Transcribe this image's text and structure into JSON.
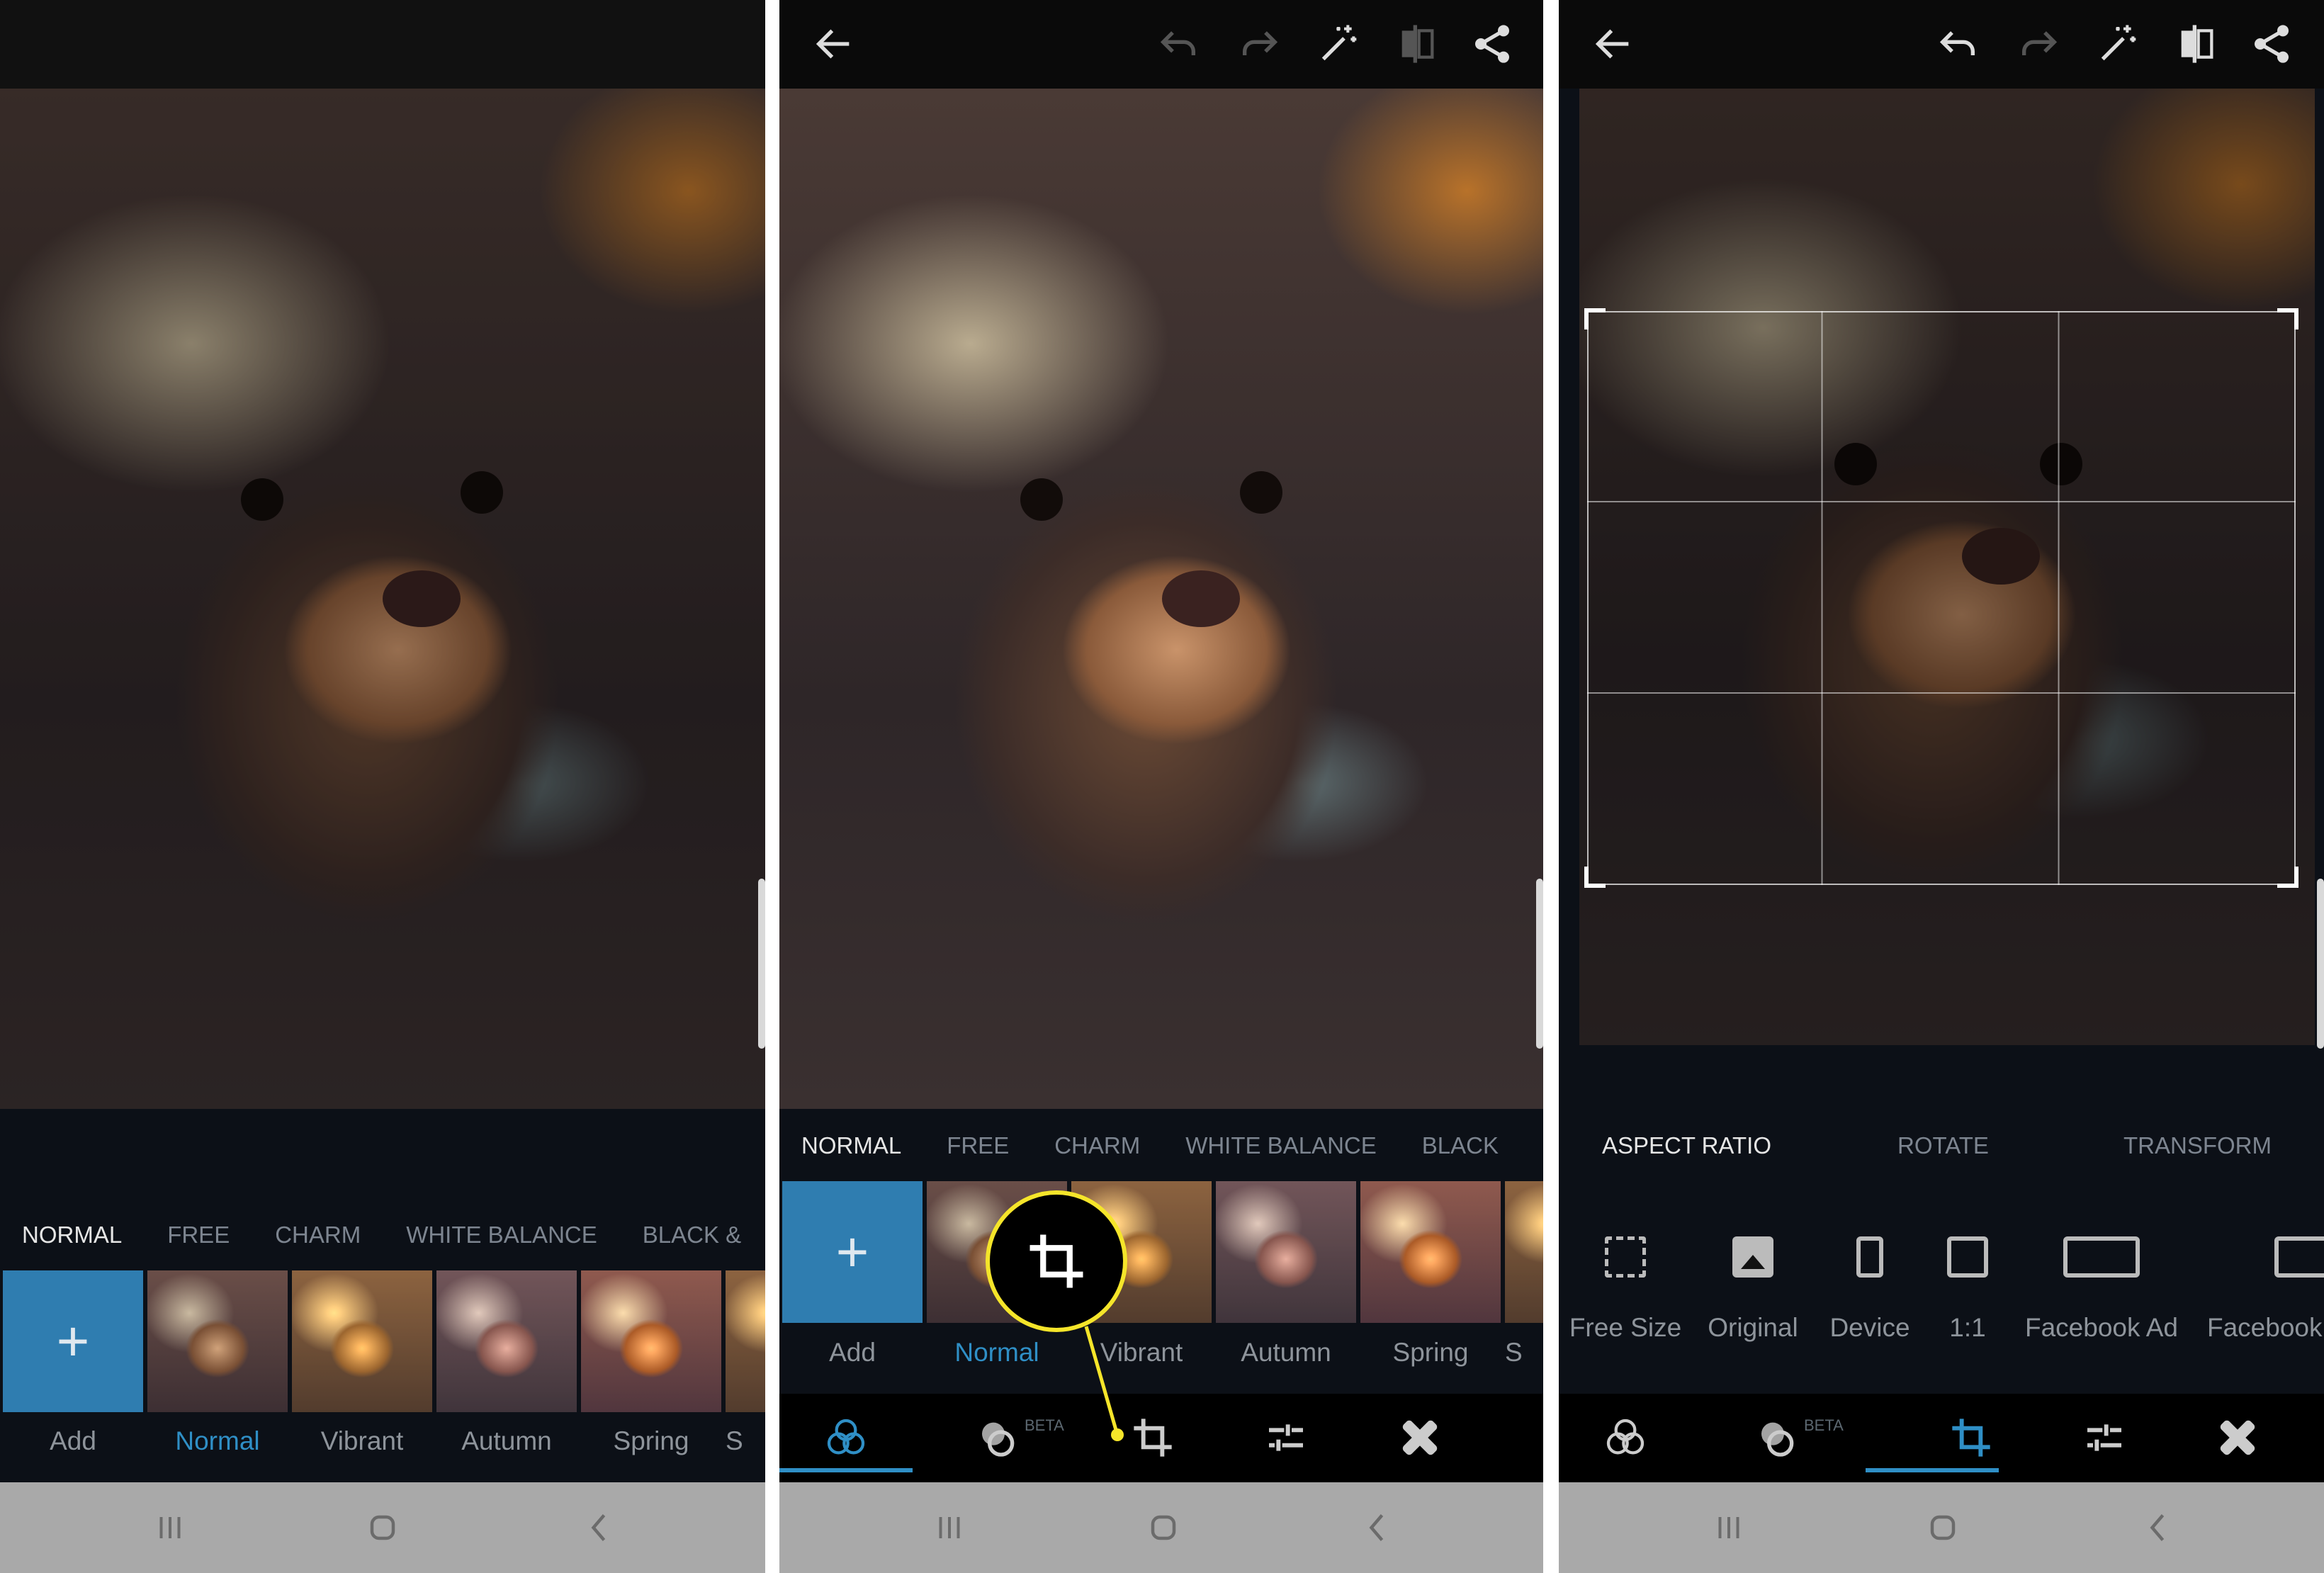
{
  "colors": {
    "accent": "#2f8fc6",
    "highlight": "#f5e52a",
    "add_tile": "#2f7db0"
  },
  "panel1": {
    "tabs": [
      "NORMAL",
      "FREE",
      "CHARM",
      "WHITE BALANCE",
      "BLACK &"
    ],
    "add_symbol": "+",
    "looks": [
      "Add",
      "Normal",
      "Vibrant",
      "Autumn",
      "Spring",
      "S"
    ]
  },
  "panel2": {
    "toolbar_icons": [
      "back-arrow",
      "undo",
      "redo",
      "magic-wand",
      "compare",
      "share"
    ],
    "tabs": [
      "NORMAL",
      "FREE",
      "CHARM",
      "WHITE BALANCE",
      "BLACK"
    ],
    "add_symbol": "+",
    "looks": [
      "Add",
      "Normal",
      "Vibrant",
      "Autumn",
      "Spring",
      "S"
    ],
    "beta": "BETA",
    "tools": [
      "looks",
      "heal-beta",
      "crop",
      "adjust",
      "healing"
    ],
    "active_tool": "looks",
    "callout_icon": "crop"
  },
  "panel3": {
    "toolbar_icons": [
      "back-arrow",
      "undo",
      "redo",
      "magic-wand",
      "compare",
      "share"
    ],
    "tabs": [
      "ASPECT RATIO",
      "ROTATE",
      "TRANSFORM"
    ],
    "ratios": [
      {
        "label": "Free Size",
        "icon": "free-size"
      },
      {
        "label": "Original",
        "icon": "image"
      },
      {
        "label": "Device",
        "icon": "phone"
      },
      {
        "label": "1:1",
        "icon": "square"
      },
      {
        "label": "Facebook Ad",
        "icon": "wide-rect"
      },
      {
        "label": "Facebook",
        "icon": "rect"
      }
    ],
    "beta": "BETA",
    "active_tool": "crop"
  },
  "nav": [
    "recent-apps",
    "home",
    "back"
  ]
}
